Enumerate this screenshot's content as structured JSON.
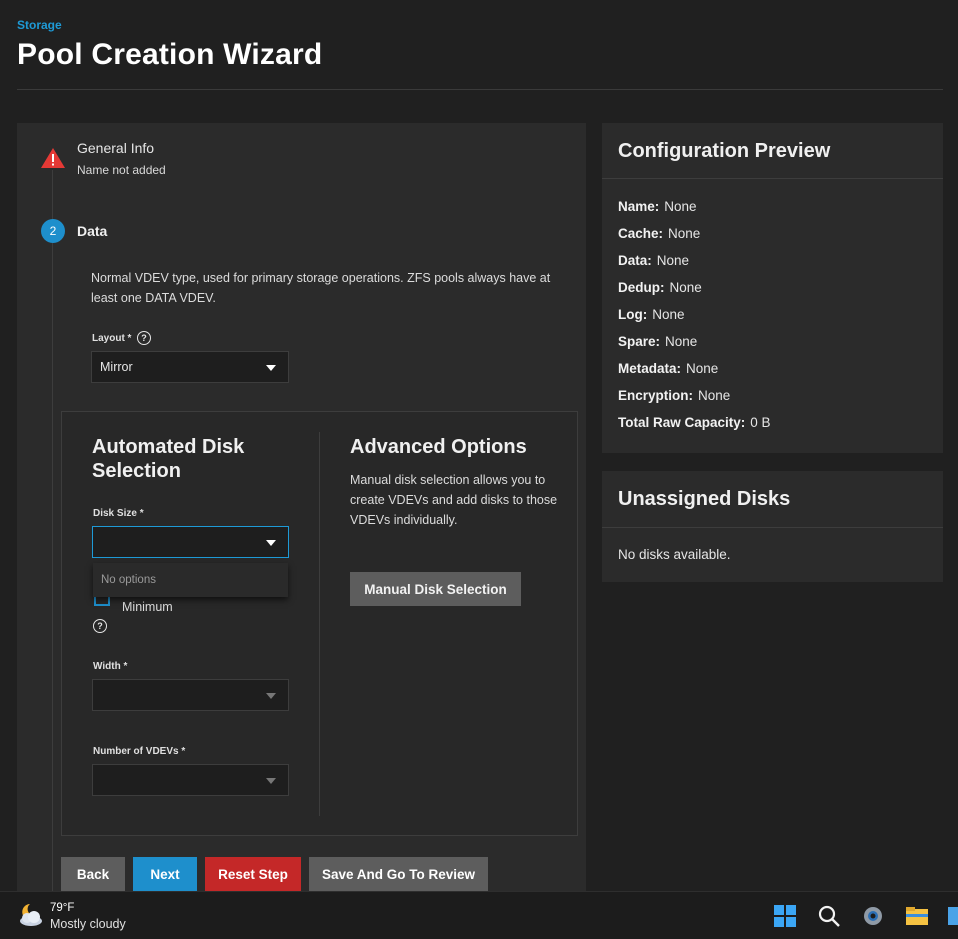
{
  "header": {
    "breadcrumb": "Storage",
    "title": "Pool Creation Wizard"
  },
  "wizard": {
    "step1": {
      "title": "General Info",
      "subtitle": "Name not added",
      "status_icon": "warning-triangle-icon"
    },
    "step2": {
      "number": "2",
      "title": "Data",
      "description": "Normal VDEV type, used for primary storage operations. ZFS pools always have at least one DATA VDEV.",
      "layout": {
        "label": "Layout *",
        "value": "Mirror",
        "help": "?"
      },
      "automated": {
        "title": "Automated Disk Selection",
        "disk_size_label": "Disk Size *",
        "disk_size_value": "",
        "dropdown_empty": "No options",
        "minimum_label": "Minimum",
        "help": "?",
        "width_label": "Width *",
        "vdevs_label": "Number of VDEVs *"
      },
      "advanced": {
        "title": "Advanced Options",
        "description": "Manual disk selection allows you to create VDEVs and add disks to those VDEVs individually.",
        "manual_button": "Manual Disk Selection"
      }
    },
    "buttons": {
      "back": "Back",
      "next": "Next",
      "reset": "Reset Step",
      "review": "Save And Go To Review"
    }
  },
  "preview": {
    "title": "Configuration Preview",
    "items": [
      {
        "key": "Name:",
        "value": "None"
      },
      {
        "key": "Cache:",
        "value": "None"
      },
      {
        "key": "Data:",
        "value": "None"
      },
      {
        "key": "Dedup:",
        "value": "None"
      },
      {
        "key": "Log:",
        "value": "None"
      },
      {
        "key": "Spare:",
        "value": "None"
      },
      {
        "key": "Metadata:",
        "value": "None"
      },
      {
        "key": "Encryption:",
        "value": "None"
      },
      {
        "key": "Total Raw Capacity:",
        "value": "0 B"
      }
    ]
  },
  "unassigned": {
    "title": "Unassigned Disks",
    "empty_text": "No disks available."
  },
  "taskbar": {
    "temperature": "79°F",
    "condition": "Mostly cloudy"
  },
  "colors": {
    "accent": "#1e8fcc",
    "link": "#1e9ad6",
    "danger": "#c42828",
    "warning": "#e53935"
  }
}
